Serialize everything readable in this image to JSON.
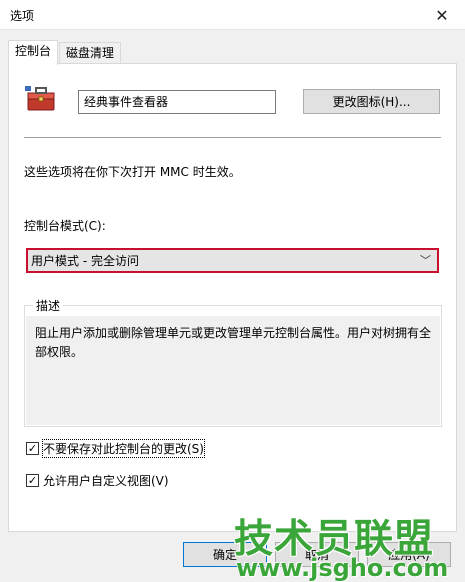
{
  "window": {
    "title": "选项"
  },
  "tabs": [
    {
      "label": "控制台",
      "active": true
    },
    {
      "label": "磁盘清理",
      "active": false
    }
  ],
  "console": {
    "name_value": "经典事件查看器",
    "change_icon_label": "更改图标(H)...",
    "note": "这些选项将在你下次打开 MMC 时生效。",
    "mode_label": "控制台模式(C):",
    "mode_value": "用户模式 - 完全访问",
    "description_legend": "描述",
    "description_text": "阻止用户添加或删除管理单元或更改管理单元控制台属性。用户对树拥有全部权限。",
    "checkbox_no_save_label": "不要保存对此控制台的更改(S)",
    "checkbox_no_save_checked": true,
    "checkbox_custom_view_label": "允许用户自定义视图(V)",
    "checkbox_custom_view_checked": true
  },
  "buttons": {
    "ok": "确定",
    "cancel": "取消",
    "apply": "应用(A)"
  },
  "watermark": {
    "main": "技术员联盟",
    "url": "www.jsgho.com"
  },
  "colors": {
    "highlight_border": "#c8102e",
    "watermark": "#3aa63a",
    "default_button_border": "#0078d7"
  },
  "icons": {
    "app": "toolbox-icon",
    "close": "close-icon",
    "dropdown": "chevron-down-icon"
  }
}
